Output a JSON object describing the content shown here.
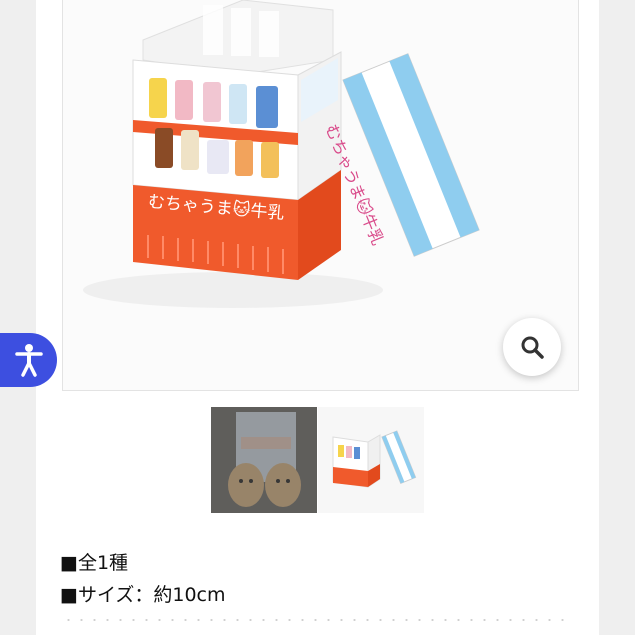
{
  "product": {
    "box_front_label": "むちゃうま🐱牛乳",
    "box_lid_label": "むちゃうま🐱牛乳",
    "thumbnails": [
      {
        "name": "plush-thumbnail",
        "state": "inactive"
      },
      {
        "name": "box-thumbnail",
        "state": "active"
      }
    ]
  },
  "specs": [
    {
      "text": "■全1種"
    },
    {
      "text": "■サイズ：約10cm"
    }
  ],
  "icons": {
    "zoom": "magnifier-icon",
    "accessibility": "accessibility-person-icon"
  },
  "colors": {
    "accent_blue": "#3d4fe0",
    "box_orange": "#f05a2c",
    "box_white": "#ffffff",
    "lid_blue": "#7ec3e8"
  }
}
